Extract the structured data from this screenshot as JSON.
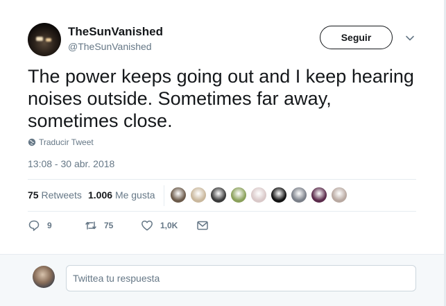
{
  "author": {
    "name": "TheSunVanished",
    "handle": "@TheSunVanished"
  },
  "follow_button_label": "Seguir",
  "tweet": {
    "text": "The power keeps going out and I keep hearing noises outside. Sometimes far away, sometimes close.",
    "translate_label": "Traducir Tweet",
    "timestamp": "13:08 - 30 abr. 2018"
  },
  "stats": {
    "retweets_count": "75",
    "retweets_label": "Retweets",
    "likes_count": "1.006",
    "likes_label": "Me gusta",
    "liker_colors": [
      "#6b5a4a",
      "#c9b79c",
      "#3a3a3a",
      "#8aa05a",
      "#d9c8c8",
      "#111111",
      "#7a7f88",
      "#5a2a4a",
      "#b8a8a0"
    ]
  },
  "actions": {
    "reply_count": "9",
    "retweet_count": "75",
    "like_count": "1,0K"
  },
  "reply": {
    "placeholder": "Twittea tu respuesta"
  },
  "colors": {
    "muted": "#657786",
    "text": "#14171a",
    "border": "#e6ecf0",
    "reply_bg": "#f5f8fa"
  },
  "icons": [
    "caret-down-icon",
    "globe-icon",
    "reply-icon",
    "retweet-icon",
    "heart-icon",
    "direct-message-icon"
  ]
}
